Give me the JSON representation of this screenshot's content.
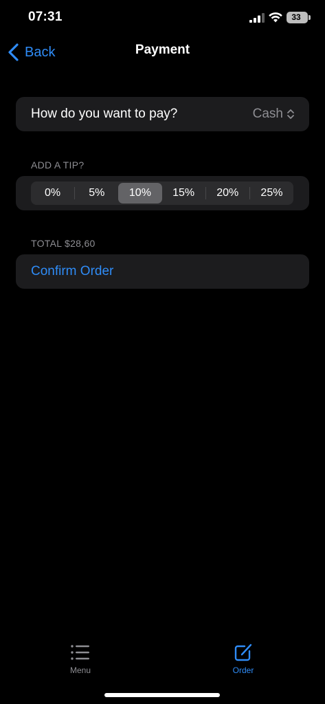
{
  "status_bar": {
    "time": "07:31",
    "battery": "33"
  },
  "nav": {
    "back_label": "Back",
    "title": "Payment"
  },
  "payment": {
    "question": "How do you want to pay?",
    "method": "Cash"
  },
  "tip": {
    "section_label": "ADD A TIP?",
    "options": [
      "0%",
      "5%",
      "10%",
      "15%",
      "20%",
      "25%"
    ],
    "selected": "10%"
  },
  "total": {
    "label": "TOTAL $28,60"
  },
  "confirm": {
    "label": "Confirm Order"
  },
  "tab_bar": {
    "items": [
      {
        "label": "Menu",
        "icon": "list-icon",
        "active": false
      },
      {
        "label": "Order",
        "icon": "compose-icon",
        "active": true
      }
    ]
  },
  "colors": {
    "accent": "#2f8cf7",
    "background": "#000000",
    "card": "#1c1c1e",
    "secondary_text": "#8e8e93",
    "segment_selected": "#636366"
  }
}
